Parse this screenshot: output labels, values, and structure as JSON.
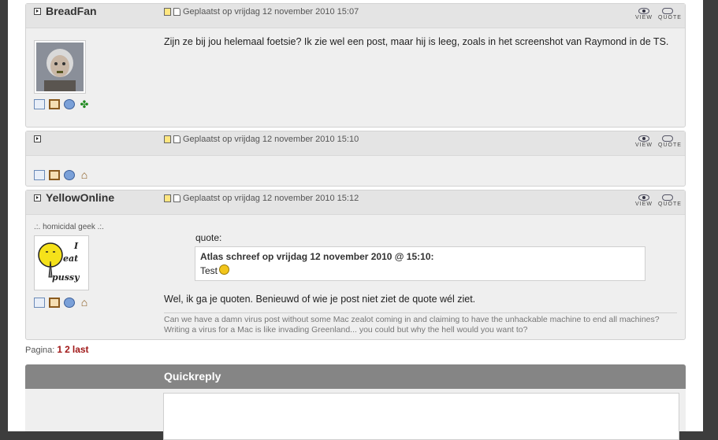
{
  "posts": [
    {
      "author": "BreadFan",
      "timestamp": "Geplaatst op vrijdag 12 november 2010 15:07",
      "body": "Zijn ze bij jou helemaal foetsie? Ik zie wel een post, maar hij is leeg, zoals in het screenshot van Raymond in de TS.",
      "view_label": "VIEW",
      "quote_label": "QUOTE"
    },
    {
      "author": "",
      "timestamp": "Geplaatst op vrijdag 12 november 2010 15:10",
      "view_label": "VIEW",
      "quote_label": "QUOTE"
    },
    {
      "author": "YellowOnline",
      "timestamp": "Geplaatst op vrijdag 12 november 2010 15:12",
      "usertitle": ".:. homicidal geek .:.",
      "avatar_text": [
        "I",
        "eat",
        "pussy"
      ],
      "quote_label": "quote:",
      "quote_header": "Atlas schreef op vrijdag 12 november 2010 @ 15:10:",
      "quote_body": "Test",
      "body": "Wel, ik ga je quoten. Benieuwd of wie je post niet ziet de quote wél ziet.",
      "signature": "Can we have a damn virus post without some Mac zealot coming in and claiming to have the unhackable machine to end all machines? Writing a virus for a Mac is like invading Greenland... you could but why the hell would you want to?",
      "view_label": "VIEW",
      "quote_btn_label": "QUOTE"
    }
  ],
  "pager": {
    "label": "Pagina:",
    "pages": [
      "1",
      "2"
    ],
    "last": "last"
  },
  "quickreply": {
    "title": "Quickreply"
  }
}
